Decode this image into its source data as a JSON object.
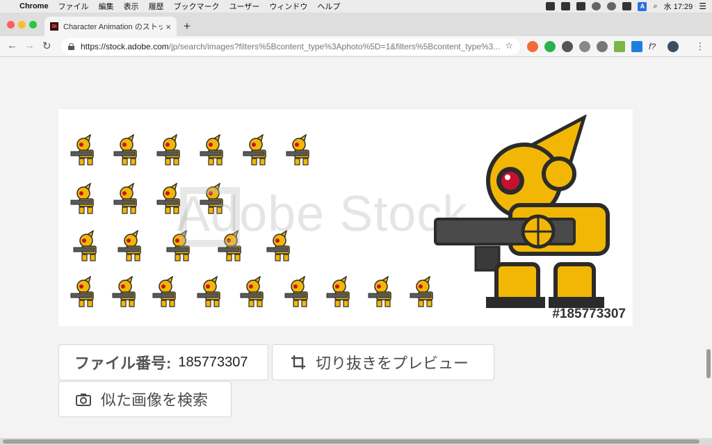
{
  "menubar": {
    "app_name": "Chrome",
    "items": [
      "ファイル",
      "編集",
      "表示",
      "履歴",
      "ブックマーク",
      "ユーザー",
      "ウィンドウ",
      "ヘルプ"
    ],
    "clock": "水 17:29",
    "input_badge": "A"
  },
  "tab": {
    "title": "Character Animation のストック",
    "favicon_text": "St"
  },
  "address": {
    "host": "https://stock.adobe.com",
    "path": "/jp/search/images?filters%5Bcontent_type%3Aphoto%5D=1&filters%5Bcontent_type%3..."
  },
  "extensions": {
    "fx_label": "f?"
  },
  "image": {
    "watermark": "Adobe Stock",
    "file_tag": "#185773307"
  },
  "actions": {
    "file_label": "ファイル番号:",
    "file_number": "185773307",
    "crop_preview": "切り抜きをプレビュー",
    "similar_search": "似た画像を検索"
  },
  "colors": {
    "robot_gold": "#f2b705",
    "robot_dark": "#2b2b2b",
    "robot_eye": "#c8102e"
  }
}
